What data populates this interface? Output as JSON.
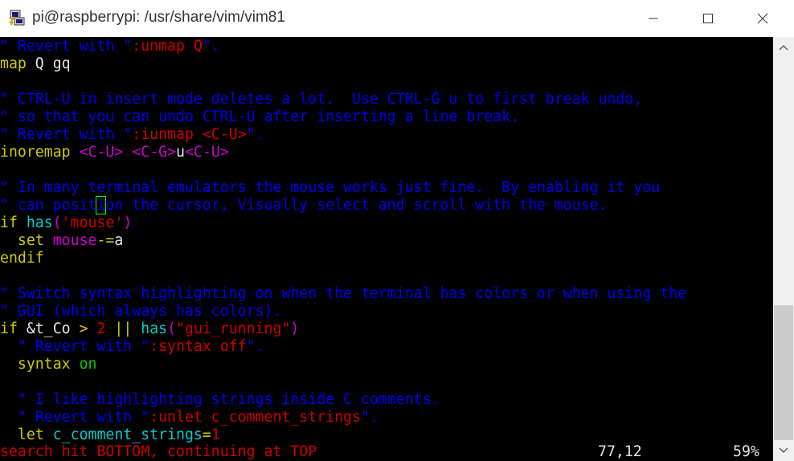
{
  "window": {
    "title": "pi@raspberrypi: /usr/share/vim/vim81",
    "icons": {
      "app": "putty-icon",
      "minimize": "minimize-icon",
      "maximize": "maximize-icon",
      "close": "close-icon"
    }
  },
  "lines": [
    [
      {
        "t": "\" Revert with \"",
        "c": "comment"
      },
      {
        "t": ":unmap Q",
        "c": "str"
      },
      {
        "t": "\".",
        "c": "comment"
      }
    ],
    [
      {
        "t": "map",
        "c": "kw"
      },
      {
        "t": " Q gq",
        "c": "txt"
      }
    ],
    [],
    [
      {
        "t": "\" CTRL-U in insert mode deletes a lot.  Use CTRL-G u to first break undo,",
        "c": "comment"
      }
    ],
    [
      {
        "t": "\" so that you can undo CTRL-U after inserting a line break.",
        "c": "comment"
      }
    ],
    [
      {
        "t": "\" Revert with \"",
        "c": "comment"
      },
      {
        "t": ":iunmap <C-U>",
        "c": "str"
      },
      {
        "t": "\".",
        "c": "comment"
      }
    ],
    [
      {
        "t": "inoremap",
        "c": "kw"
      },
      {
        "t": " ",
        "c": "txt"
      },
      {
        "t": "<C-U>",
        "c": "spc"
      },
      {
        "t": " ",
        "c": "txt"
      },
      {
        "t": "<C-G>",
        "c": "spc"
      },
      {
        "t": "u",
        "c": "txt"
      },
      {
        "t": "<C-U>",
        "c": "spc"
      }
    ],
    [],
    [
      {
        "t": "\" In many terminal emulators the mouse works just fine.  By enabling it you",
        "c": "comment"
      }
    ],
    [
      {
        "t": "\" can posit",
        "c": "comment"
      },
      {
        "t": "i",
        "c": "cursor"
      },
      {
        "t": "on the cursor, Visually select and scroll with the mouse.",
        "c": "comment"
      }
    ],
    [
      {
        "t": "if",
        "c": "kw"
      },
      {
        "t": " ",
        "c": "txt"
      },
      {
        "t": "has",
        "c": "fn"
      },
      {
        "t": "(",
        "c": "opt"
      },
      {
        "t": "'mouse'",
        "c": "str"
      },
      {
        "t": ")",
        "c": "opt"
      }
    ],
    [
      {
        "t": "  ",
        "c": "txt"
      },
      {
        "t": "set",
        "c": "kw"
      },
      {
        "t": " ",
        "c": "txt"
      },
      {
        "t": "mouse",
        "c": "opt"
      },
      {
        "t": "-=",
        "c": "op"
      },
      {
        "t": "a",
        "c": "txt"
      }
    ],
    [
      {
        "t": "endif",
        "c": "kw"
      }
    ],
    [],
    [
      {
        "t": "\" Switch syntax highlighting on when the terminal has colors or when using the",
        "c": "comment"
      }
    ],
    [
      {
        "t": "\" GUI (which always has colors).",
        "c": "comment"
      }
    ],
    [
      {
        "t": "if",
        "c": "kw"
      },
      {
        "t": " &t_Co ",
        "c": "txt"
      },
      {
        "t": ">",
        "c": "op"
      },
      {
        "t": " ",
        "c": "txt"
      },
      {
        "t": "2",
        "c": "num"
      },
      {
        "t": " ",
        "c": "txt"
      },
      {
        "t": "||",
        "c": "op"
      },
      {
        "t": " ",
        "c": "txt"
      },
      {
        "t": "has",
        "c": "fn"
      },
      {
        "t": "(",
        "c": "opt"
      },
      {
        "t": "\"gui_running\"",
        "c": "str"
      },
      {
        "t": ")",
        "c": "opt"
      }
    ],
    [
      {
        "t": "  \" Revert with \"",
        "c": "comment"
      },
      {
        "t": ":syntax off",
        "c": "str"
      },
      {
        "t": "\".",
        "c": "comment"
      }
    ],
    [
      {
        "t": "  ",
        "c": "txt"
      },
      {
        "t": "syntax",
        "c": "kw"
      },
      {
        "t": " ",
        "c": "txt"
      },
      {
        "t": "on",
        "c": "grn"
      }
    ],
    [],
    [
      {
        "t": "  \" I like highlighting strings inside C comments.",
        "c": "comment"
      }
    ],
    [
      {
        "t": "  \" Revert with \"",
        "c": "comment"
      },
      {
        "t": ":unlet c_comment_strings",
        "c": "str"
      },
      {
        "t": "\".",
        "c": "comment"
      }
    ],
    [
      {
        "t": "  ",
        "c": "txt"
      },
      {
        "t": "let",
        "c": "kw"
      },
      {
        "t": " ",
        "c": "txt"
      },
      {
        "t": "c_comment_strings",
        "c": "fn"
      },
      {
        "t": "=",
        "c": "op"
      },
      {
        "t": "1",
        "c": "num"
      }
    ]
  ],
  "status": {
    "message": "search hit BOTTOM, continuing at TOP",
    "position": "77,12",
    "percent": "59%"
  },
  "scrollbar": {
    "position_fraction": 0.63,
    "thumb_fraction": 0.32
  }
}
